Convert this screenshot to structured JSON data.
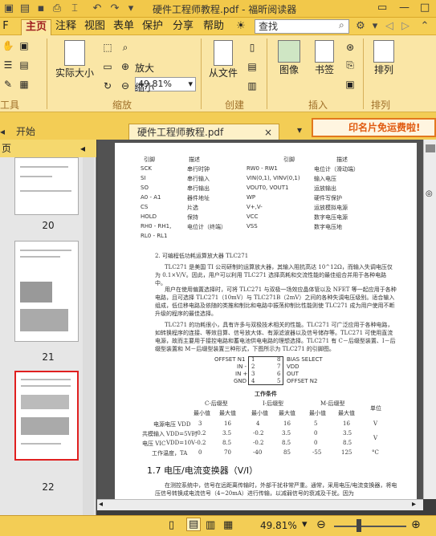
{
  "window": {
    "title": "硬件工程师教程.pdf - 福昕阅读器",
    "search_placeholder": "查找"
  },
  "menu": {
    "items": [
      "主页",
      "注释",
      "视图",
      "表单",
      "保护",
      "分享",
      "帮助"
    ],
    "active": "主页",
    "left_partial": "F"
  },
  "ribbon": {
    "zoom_value": "49.81%",
    "actual_size": "实际大小",
    "zoom_in": "放大",
    "zoom_out": "缩小",
    "from_file": "从文件",
    "image": "图像",
    "bookmark": "书签",
    "arrange": "排列",
    "groups": {
      "tools": "工具",
      "zoom": "缩放",
      "create": "创建",
      "insert": "插入",
      "arrange": "排列"
    }
  },
  "tabs": {
    "start": "开始",
    "document": "硬件工程师教程.pdf",
    "close": "×"
  },
  "promo": {
    "text": "印名片免运费啦!"
  },
  "sidebar": {
    "header": "页",
    "pages": [
      "20",
      "21",
      "22"
    ]
  },
  "document": {
    "table_headers": [
      "引脚",
      "描述",
      "引脚",
      "描述"
    ],
    "pin_rows": [
      [
        "SCK",
        "串行时钟",
        "RW0 - RW1",
        "电位计（滑动端）"
      ],
      [
        "SI",
        "串行输入",
        "VIN(0,1), VINV(0,1)",
        "输入电压"
      ],
      [
        "SO",
        "串行输出",
        "VOUT0, VOUT1",
        "运放输出"
      ],
      [
        "A0 - A1",
        "器件地址",
        "WP",
        "硬件写保护"
      ],
      [
        "CS",
        "片选",
        "V+,V-",
        "运放模拟电源"
      ],
      [
        "HOLD",
        "保持",
        "VCC",
        "数字电压电源"
      ],
      [
        "RH0 - RH1,",
        "电位计（终端）",
        "VSS",
        "数字电压地"
      ],
      [
        "RL0 - RL1",
        "",
        "",
        ""
      ]
    ],
    "section2": "2. 可编程低功耗运算放大器 TLC271",
    "para1": "TLC271 是美国 TI 公司研制的运算放大器，其输入阻抗高达 10^12Ω，而输入失调电压仅为 0.1×V/V。因此，用户可以利用 TLC271 选择高耗和交流性能的最佳组合并用于各种电路中。",
    "para2": "用户在使用偏置选择时，可将 TLC271 与双极一场效应晶体管以及 NFET 等一起应用于各种电路，且可选择 TLC271（10mV）与 TLC271B（2mV）之间的各种失调电压级别。适合输入组成，低位移电路及依随的类推和制比和电路中振荡抑制比性能则使 TLC271 成为用户使用不断升级的程序的最佳选择。",
    "para3": "TLC271 的功耗很小，具有许多与双极技术相关的性能。TLC271 可广泛应用于各种电路，如转换程序的连接、等效目算、信号放大体、有源滤波器以及信号储存等。TLC271 可使用直流电源，故而主要用于接控电路和蓄电池供电电路的理想选择。TLC271 有 C－后缀型装置、I－后缀型装置和 M－后缀型装置三种形式，下图所示为 TLC271 的引脚图。",
    "ic_left_pins": [
      "OFFSET N1",
      "IN -",
      "IN +",
      "GND"
    ],
    "ic_left_nums": [
      "1",
      "2",
      "3",
      "4"
    ],
    "ic_right_nums": [
      "8",
      "7",
      "6",
      "5"
    ],
    "ic_right_pins": [
      "BIAS SELECT",
      "VDD",
      "OUT",
      "OFFSET N2"
    ],
    "cond_title": "工作条件",
    "cond_groups": [
      "C-后缀型",
      "I-后缀型",
      "M-后缀型"
    ],
    "cond_sub": [
      "最小值",
      "最大值",
      "最小值",
      "最大值",
      "最小值",
      "最大值",
      "单位"
    ],
    "cond_rows": [
      [
        "电源电压 VDD",
        "",
        "3",
        "16",
        "4",
        "16",
        "5",
        "16",
        "V"
      ],
      [
        "共模输入",
        "VDD=5V时",
        "-0.2",
        "3.5",
        "-0.2",
        "3.5",
        "0",
        "3.5",
        ""
      ],
      [
        "电压 VIC",
        "VDD=10V",
        "-0.2",
        "8.5",
        "-0.2",
        "8.5",
        "0",
        "8.5",
        "V"
      ],
      [
        "工作温度，TA",
        "",
        "0",
        "70",
        "-40",
        "85",
        "-55",
        "125",
        "°C"
      ]
    ],
    "section17": "1.7  电压/电流变换器（V/I）",
    "para4": "在测控系统中，信号在远距离传输时，外部干扰非常严重。通常，采用电压/电流变换器，将电压信号转换成电流信号（4~20mA）进行传输，以减弱信号的衰减及干扰。因为"
  },
  "status": {
    "zoom": "49.81%"
  }
}
